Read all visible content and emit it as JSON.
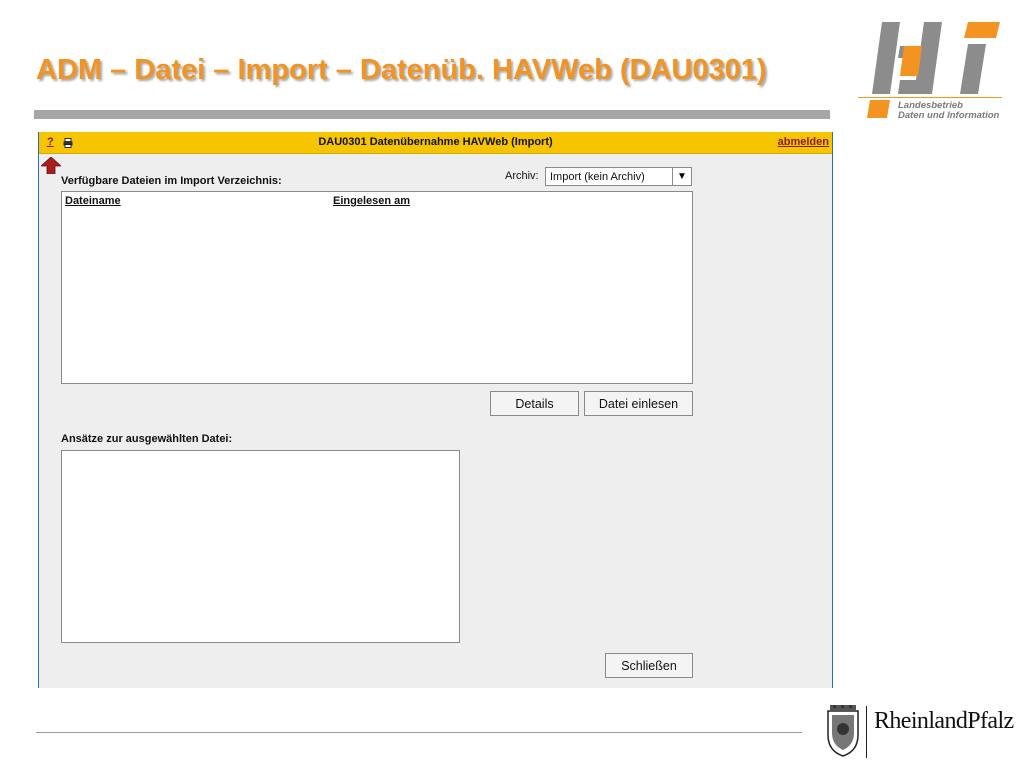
{
  "slide": {
    "title": "ADM – Datei – Import – Datenüb. HAVWeb (DAU0301)"
  },
  "logo": {
    "letters": "ldi",
    "line1": "Landesbetrieb",
    "line2": "Daten und Information"
  },
  "app": {
    "header": {
      "help": "?",
      "title": "DAU0301 Datenübernahme HAVWeb (Import)",
      "logout": "abmelden"
    },
    "files_label": "Verfügbare Dateien im Import Verzeichnis:",
    "archiv": {
      "label": "Archiv:",
      "selected": "Import (kein Archiv)"
    },
    "table": {
      "columns": [
        "Dateiname",
        "Eingelesen am"
      ],
      "rows": []
    },
    "buttons": {
      "details": "Details",
      "read_file": "Datei einlesen",
      "close": "Schließen"
    },
    "approaches_label": "Ansätze zur ausgewählten Datei:"
  },
  "footer": {
    "state": "RheinlandPfalz"
  },
  "colors": {
    "title_orange": "#f39422",
    "header_yellow": "#f7c400",
    "link_red": "#8b1a1a",
    "window_border": "#2a6fb6"
  }
}
